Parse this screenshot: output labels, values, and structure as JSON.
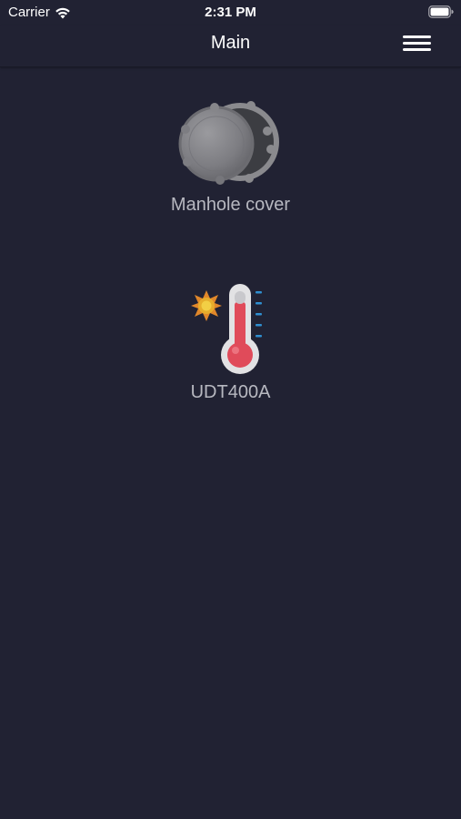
{
  "status_bar": {
    "carrier": "Carrier",
    "time": "2:31 PM",
    "wifi_icon": "wifi-icon",
    "battery_icon": "battery-icon"
  },
  "nav": {
    "title": "Main",
    "menu_icon": "hamburger-menu-icon"
  },
  "devices": [
    {
      "label": "Manhole cover",
      "icon": "manhole-cover-icon"
    },
    {
      "label": "UDT400A",
      "icon": "thermometer-icon"
    }
  ],
  "colors": {
    "background": "#212233",
    "label": "#b7b8c0",
    "text": "#ffffff"
  }
}
